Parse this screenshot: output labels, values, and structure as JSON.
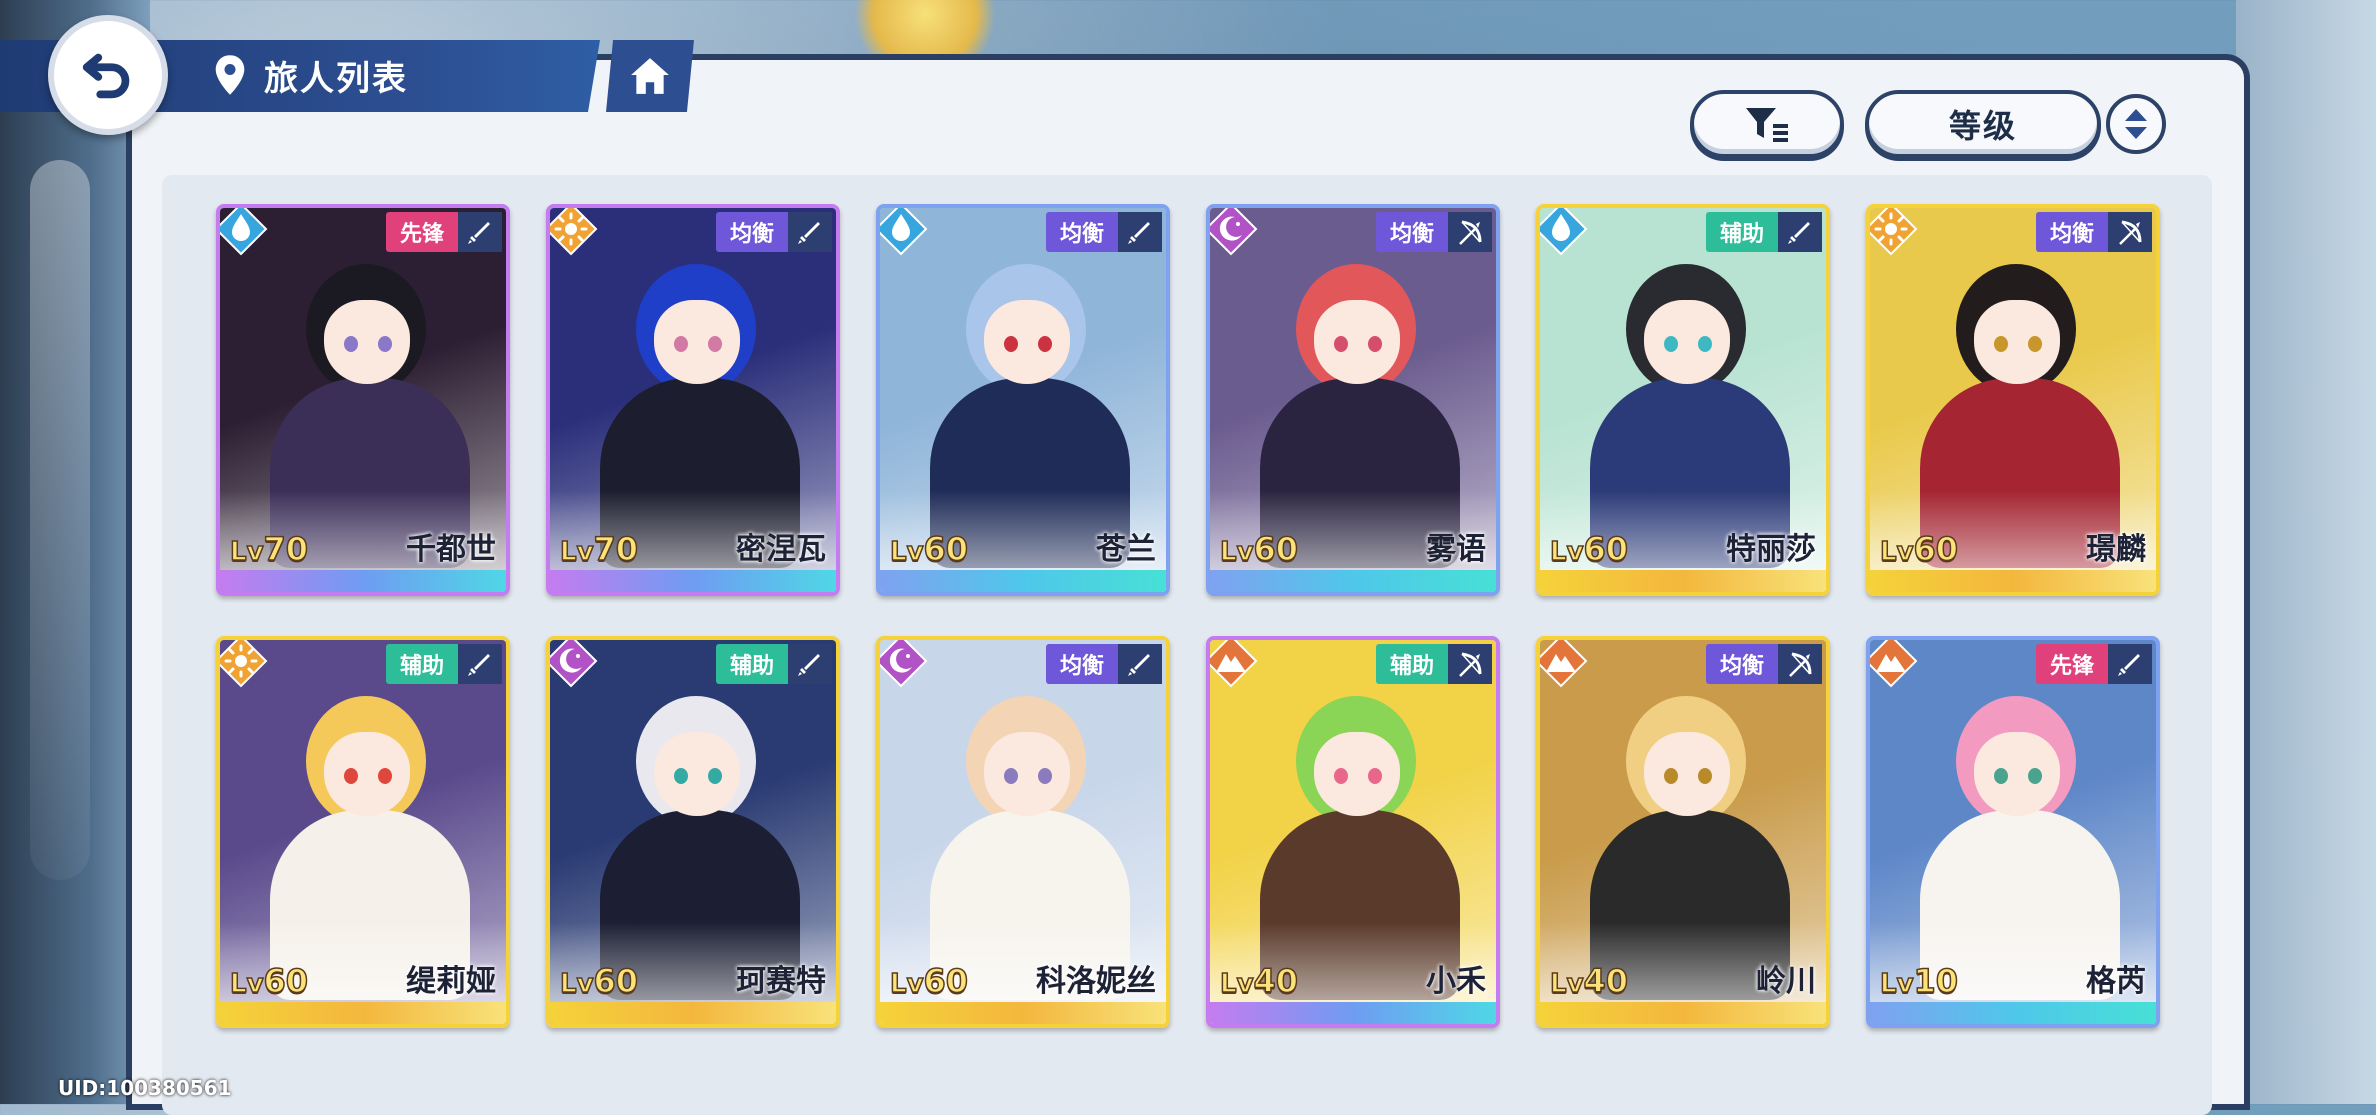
{
  "header": {
    "title": "旅人列表"
  },
  "controls": {
    "sort_label": "等级"
  },
  "uid": "UID:100380561",
  "characters": [
    {
      "level_prefix": "Lv",
      "level": "70",
      "name": "千都世",
      "role": "先锋",
      "element": "water",
      "weapon": "sword",
      "role_color": "#e0417a",
      "rarity": "purple",
      "theme": "#2d1f33",
      "hair": "#1b1a22",
      "outfit": "#3b2f58",
      "eye": "#8a78c8"
    },
    {
      "level_prefix": "Lv",
      "level": "70",
      "name": "密涅瓦",
      "role": "均衡",
      "element": "sun",
      "weapon": "sword",
      "role_color": "#6f57d9",
      "rarity": "purple",
      "theme": "#2b2f7a",
      "hair": "#1f3fc8",
      "outfit": "#1c1d2e",
      "eye": "#d37aa4"
    },
    {
      "level_prefix": "Lv",
      "level": "60",
      "name": "苍兰",
      "role": "均衡",
      "element": "water",
      "weapon": "sword",
      "role_color": "#6f57d9",
      "rarity": "blue",
      "theme": "#8fb5d9",
      "hair": "#a9c5ea",
      "outfit": "#1f2c57",
      "eye": "#cc3340"
    },
    {
      "level_prefix": "Lv",
      "level": "60",
      "name": "雾语",
      "role": "均衡",
      "element": "moon",
      "weapon": "bow",
      "role_color": "#6f57d9",
      "rarity": "blue",
      "theme": "#6b5c8f",
      "hair": "#e2575a",
      "outfit": "#2a2440",
      "eye": "#d64e6d"
    },
    {
      "level_prefix": "Lv",
      "level": "60",
      "name": "特丽莎",
      "role": "辅助",
      "element": "water",
      "weapon": "sword",
      "role_color": "#2dbd98",
      "rarity": "gold",
      "theme": "#b8e3d2",
      "hair": "#2a2b30",
      "outfit": "#2b3a78",
      "eye": "#3fb9c1"
    },
    {
      "level_prefix": "Lv",
      "level": "60",
      "name": "璟麟",
      "role": "均衡",
      "element": "sun",
      "weapon": "bow",
      "role_color": "#6f57d9",
      "rarity": "gold",
      "theme": "#e9c94b",
      "hair": "#221d1c",
      "outfit": "#a52532",
      "eye": "#c8962a"
    },
    {
      "level_prefix": "Lv",
      "level": "60",
      "name": "缇莉娅",
      "role": "辅助",
      "element": "sun",
      "weapon": "sword",
      "role_color": "#2dbd98",
      "rarity": "gold",
      "theme": "#5a4a8c",
      "hair": "#f4c95a",
      "outfit": "#f5f1ea",
      "eye": "#e0473c"
    },
    {
      "level_prefix": "Lv",
      "level": "60",
      "name": "珂赛特",
      "role": "辅助",
      "element": "moon",
      "weapon": "sword",
      "role_color": "#2dbd98",
      "rarity": "gold",
      "theme": "#2a3b73",
      "hair": "#e8e8ee",
      "outfit": "#1c1f33",
      "eye": "#35a9a4"
    },
    {
      "level_prefix": "Lv",
      "level": "60",
      "name": "科洛妮丝",
      "role": "均衡",
      "element": "moon",
      "weapon": "sword",
      "role_color": "#6f57d9",
      "rarity": "gold",
      "theme": "#c8d6ea",
      "hair": "#f3d4b4",
      "outfit": "#f7f4ee",
      "eye": "#8a7bbf"
    },
    {
      "level_prefix": "Lv",
      "level": "40",
      "name": "小禾",
      "role": "辅助",
      "element": "mountain",
      "weapon": "bow",
      "role_color": "#2dbd98",
      "rarity": "purple",
      "theme": "#f2d247",
      "hair": "#8ad456",
      "outfit": "#5a3a2a",
      "eye": "#e8678a"
    },
    {
      "level_prefix": "Lv",
      "level": "40",
      "name": "岭川",
      "role": "均衡",
      "element": "mountain",
      "weapon": "bow",
      "role_color": "#6f57d9",
      "rarity": "gold",
      "theme": "#c99b4a",
      "hair": "#f0cf82",
      "outfit": "#2a2a2a",
      "eye": "#b88a2a"
    },
    {
      "level_prefix": "Lv",
      "level": "10",
      "name": "格芮",
      "role": "先锋",
      "element": "mountain",
      "weapon": "sword",
      "role_color": "#e0417a",
      "rarity": "blue",
      "theme": "#5e87c8",
      "hair": "#f39ac0",
      "outfit": "#f7f4f0",
      "eye": "#49a38e"
    }
  ],
  "colors": {
    "header_blue": "#2d4f92",
    "panel_border": "#2b3f62",
    "frame_purple": "#b06ee8",
    "frame_blue": "#52d0e8",
    "frame_gold": "#f2cf3d"
  }
}
